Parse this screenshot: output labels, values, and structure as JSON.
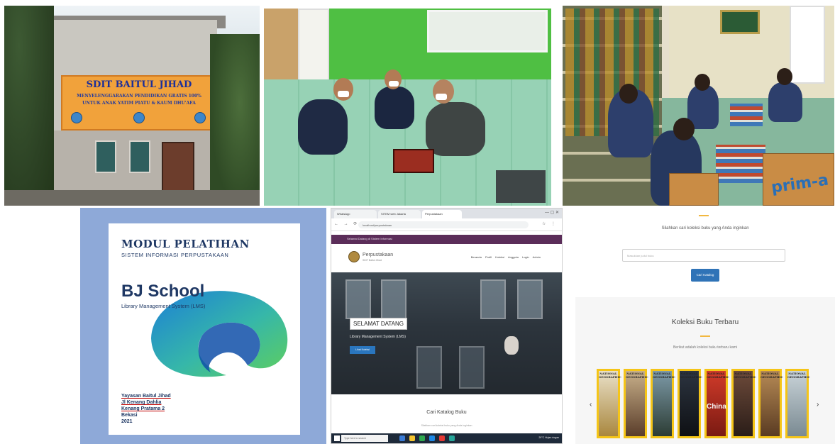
{
  "photo_building": {
    "banner_title": "SDIT BAITUL JIHAD",
    "banner_line2": "MENYELENGGARAKAN PENDIDIKAN GRATIS 100%",
    "banner_line3": "UNTUK ANAK YATIM PIATU & KAUM DHU'AFA"
  },
  "module_cover": {
    "title": "MODUL PELATIHAN",
    "subtitle": "SISTEM INFORMASI PERPUSTAKAAN",
    "brand": "BJ School",
    "brand_sub": "Library Management System (LMS)",
    "footer_org": "Yayasan Baitul Jihad",
    "footer_addr1": "Jl Kenang Dahlia",
    "footer_addr2": "Kenang Pratama 2",
    "footer_city": "Bekasi",
    "footer_year": "2021",
    "logo_colors": [
      "#1c7fd6",
      "#36b7a9",
      "#5fcf5c"
    ]
  },
  "browser": {
    "tabs": [
      "WhatsApp",
      "SITEM web Jakarta",
      "Perpustakaan"
    ],
    "url": "localhost/perpustakaan",
    "topbar_text": "Selamat Datang di Sistem Informasi",
    "site_name": "Perpustakaan",
    "site_sub": "SDIT Baitul Jihad",
    "nav_links": "Beranda Profil Koleksi Anggota Login Admin",
    "hero_title": "SELAMAT DATANG",
    "hero_sub": "Library Management System (LMS)",
    "hero_button": "Lihat Koleksi",
    "catalog_title": "Cari Katalog Buku",
    "catalog_sub": "Silahkan cari koleksi buku yang Anda inginkan",
    "taskbar_search": "Type here to search",
    "tray": "29°C Hujan ringan",
    "accent": "#5b2d59"
  },
  "site_lower": {
    "find_text": "Silahkan cari koleksi buku yang Anda inginkan",
    "input_placeholder": "Masukkan judul buku",
    "search_button": "Cari Katalog",
    "collection_title": "Koleksi Buku Terbaru",
    "collection_sub": "Berikut adalah koleksi buku terbaru kami",
    "magazines": [
      "NATIONAL GEOGRAPHIC",
      "NATIONAL GEOGRAPHIC",
      "NATIONAL GEOGRAPHIC",
      "NATIONAL GEOGRAPHIC",
      "NATIONAL GEOGRAPHIC",
      "NATIONAL GEOGRAPHIC",
      "NATIONAL GEOGRAPHIC",
      "NATIONAL GEOGRAPHIC"
    ],
    "magazine_china": "China",
    "prev_icon": "chevron-left-icon",
    "next_icon": "chevron-right-icon"
  },
  "box_print": "prim-a"
}
